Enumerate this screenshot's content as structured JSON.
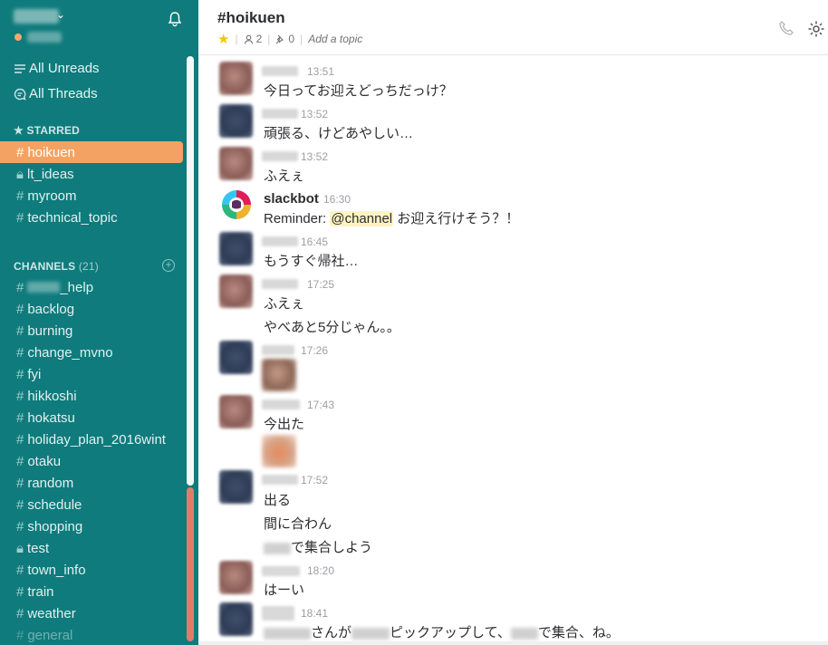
{
  "sidebar": {
    "all_unreads": "All Unreads",
    "all_threads": "All Threads",
    "starred_title": "STARRED",
    "starred": [
      {
        "name": "hoikuen",
        "private": false,
        "active": true
      },
      {
        "name": "lt_ideas",
        "private": true,
        "active": false
      },
      {
        "name": "myroom",
        "private": false,
        "active": false
      },
      {
        "name": "technical_topic",
        "private": false,
        "active": false
      }
    ],
    "channels_title": "CHANNELS",
    "channels_count": "(21)",
    "channels": [
      {
        "name": "_help",
        "private": false
      },
      {
        "name": "backlog",
        "private": false
      },
      {
        "name": "burning",
        "private": false
      },
      {
        "name": "change_mvno",
        "private": false
      },
      {
        "name": "fyi",
        "private": false
      },
      {
        "name": "hikkoshi",
        "private": false
      },
      {
        "name": "hokatsu",
        "private": false
      },
      {
        "name": "holiday_plan_2016wint",
        "private": false
      },
      {
        "name": "otaku",
        "private": false
      },
      {
        "name": "random",
        "private": false
      },
      {
        "name": "schedule",
        "private": false
      },
      {
        "name": "shopping",
        "private": false
      },
      {
        "name": "test",
        "private": true
      },
      {
        "name": "town_info",
        "private": false
      },
      {
        "name": "train",
        "private": false
      },
      {
        "name": "weather",
        "private": false
      },
      {
        "name": "general",
        "private": false
      }
    ]
  },
  "header": {
    "title": "#hoikuen",
    "members": "2",
    "pins": "0",
    "topic": "Add a topic",
    "colors": {
      "star": "#f2c40f",
      "sidebar": "#0f7b7c",
      "active": "#f4a263"
    }
  },
  "messages": [
    {
      "time": "13:51",
      "text": "今日ってお迎えどっちだっけ？"
    },
    {
      "time": "13:52",
      "text": "頑張る、けどあやしい…"
    },
    {
      "time": "13:52",
      "text": "ふえぇ"
    },
    {
      "user": "slackbot",
      "time": "16:30",
      "prefix": "Reminder: ",
      "mention": "@channel",
      "suffix": " お迎え行けそう？！"
    },
    {
      "time": "16:45",
      "text": "もうすぐ帰社…"
    },
    {
      "time": "17:25",
      "text": "ふえぇ",
      "text2": "やべあと5分じゃん。。"
    },
    {
      "time": "17:26"
    },
    {
      "time": "17:43",
      "text": "今出た"
    },
    {
      "time": "17:52",
      "text": "出る",
      "text2": "間に合わん",
      "text3": "で集合しよう"
    },
    {
      "time": "18:20",
      "text": "はーい"
    },
    {
      "time": "18:41",
      "t1": "さんが",
      "t2": "ピックアップして、",
      "t3": "で集合、ね。"
    }
  ]
}
